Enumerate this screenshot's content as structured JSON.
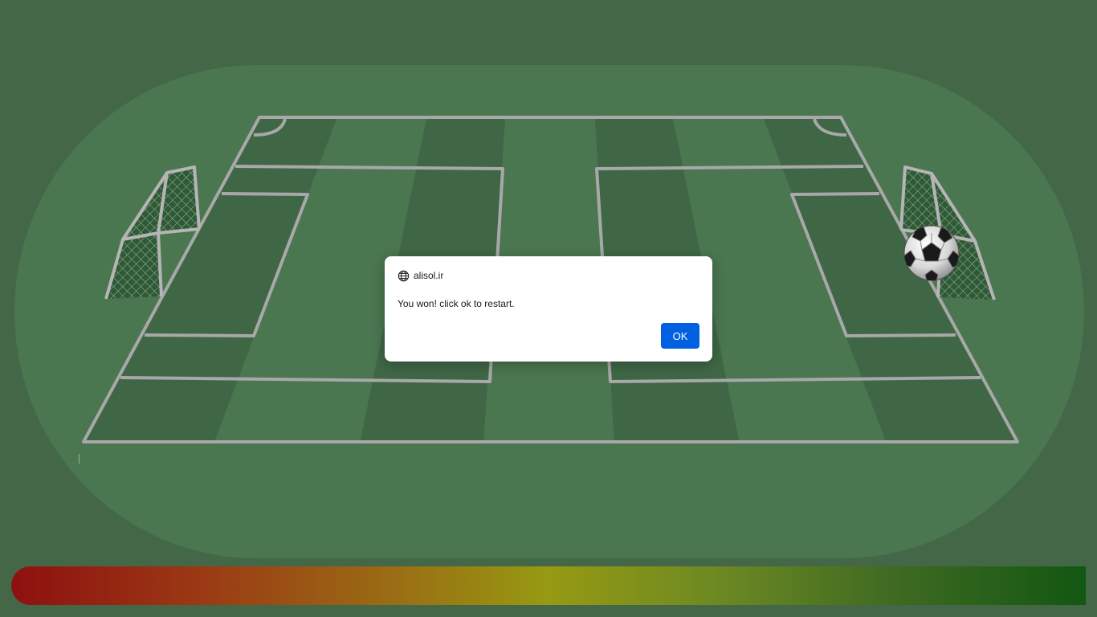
{
  "dialog": {
    "origin": "alisol.ir",
    "origin_icon": "globe-icon",
    "message": "You won! click ok to restart.",
    "ok_label": "OK"
  },
  "game": {
    "ball_icon": "soccer-ball-icon",
    "power_meter_colors": [
      "#8e1010",
      "#979a12",
      "#125712"
    ]
  },
  "colors": {
    "background": "#436747",
    "field": "#4a7650",
    "stripe_dark": "#3f6745",
    "line": "#a8a8a8",
    "dialog_button": "#0060df"
  }
}
